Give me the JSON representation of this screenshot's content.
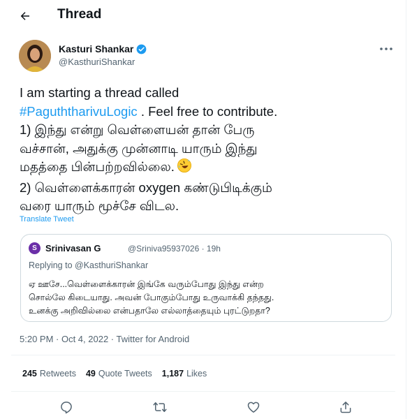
{
  "header": {
    "title": "Thread"
  },
  "tweet": {
    "author_name": "Kasturi Shankar",
    "author_handle": "@KasthuriShankar",
    "body": {
      "line1": "I am starting a thread called",
      "hashtag": "#PaguththarivuLogic",
      "line2_rest": " . Feel free to contribute.",
      "line3": "1) இந்து என்று வெள்ளையன் தான்  பேரு",
      "line4": "வச்சான், அதுக்கு முன்னாடி  யாரும் இந்து",
      "line5": "மதத்தை பின்பற்றவில்லை.",
      "line6": "2) வெள்ளைக்காரன் oxygen கண்டுபிடிக்கும்",
      "line7": "வரை யாரும் மூச்சே விடல."
    },
    "translate_label": "Translate Tweet",
    "timestamp": "5:20 PM · Oct 4, 2022 · Twitter for Android"
  },
  "quote": {
    "avatar_letter": "S",
    "name": "Srinivasan G",
    "handle_time": "@Sriniva95937026 · 19h",
    "replying_prefix": "Replying to ",
    "replying_handle": "@KasthuriShankar",
    "line1": "ஏ ஊசே...வெள்ளைக்காரன் இங்கே வரும்போது இந்து என்ற",
    "line2": "சொல்லே கிடையாது. அவன் போகும்போது உருவாக்கி தந்தது.",
    "line3": "உனக்கு அறிவில்லை என்பதாலே எல்லாத்தையும் புரட்டுறதா?"
  },
  "stats": {
    "retweets_count": "245",
    "retweets_label": "Retweets",
    "quotes_count": "49",
    "quotes_label": "Quote Tweets",
    "likes_count": "1,187",
    "likes_label": "Likes"
  },
  "colors": {
    "accent": "#1d9bf0",
    "secondary_text": "#536471",
    "border": "#cfd9de",
    "quote_avatar": "#6b2fa8"
  },
  "icons": {
    "back": "arrow-left-icon",
    "verified": "verified-badge-icon",
    "more": "more-horizontal-icon",
    "emoji": "rolling-on-floor-laughing-emoji",
    "reply": "reply-icon",
    "retweet": "retweet-icon",
    "like": "heart-icon",
    "share": "share-icon"
  }
}
